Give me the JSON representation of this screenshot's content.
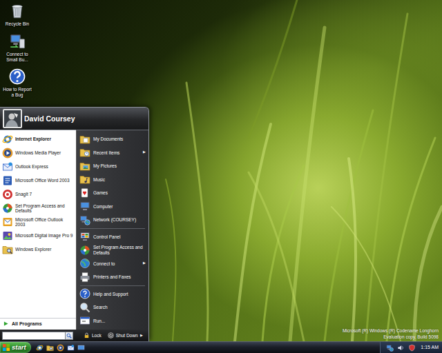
{
  "desktop": {
    "icons": [
      {
        "label": "Recycle Bin"
      },
      {
        "label": "Connect to Small Bu..."
      },
      {
        "label": "How to Report a Bug"
      }
    ]
  },
  "start_menu": {
    "user": "David Coursey",
    "pinned": [
      {
        "label": "Internet Explorer",
        "bold": true
      },
      {
        "label": "Windows Media Player",
        "bold": false
      },
      {
        "label": "Outlook Express",
        "bold": false
      },
      {
        "label": "Microsoft Office Word 2003",
        "bold": false
      },
      {
        "label": "SnagIt 7",
        "bold": false
      },
      {
        "label": "Set Program Access and Defaults",
        "bold": false
      },
      {
        "label": "Microsoft Office Outlook 2003",
        "bold": false
      },
      {
        "label": "Microsoft Digital Image Pro 9",
        "bold": false
      },
      {
        "label": "Windows Explorer",
        "bold": false
      }
    ],
    "all_programs": "All Programs",
    "submenu_arrow": "▶",
    "place_groups": [
      {
        "items": [
          {
            "label": "My Documents",
            "submenu": false
          },
          {
            "label": "Recent Items",
            "submenu": true
          },
          {
            "label": "My Pictures",
            "submenu": false
          },
          {
            "label": "Music",
            "submenu": false
          },
          {
            "label": "Games",
            "submenu": false
          },
          {
            "label": "Computer",
            "submenu": false
          },
          {
            "label": "Network (COURSEY)",
            "submenu": false
          }
        ]
      },
      {
        "items": [
          {
            "label": "Control Panel",
            "submenu": false
          },
          {
            "label": "Set Program Access and Defaults",
            "submenu": false
          },
          {
            "label": "Connect to",
            "submenu": true
          },
          {
            "label": "Printers and Faxes",
            "submenu": false
          }
        ]
      },
      {
        "items": [
          {
            "label": "Help and Support",
            "submenu": false
          },
          {
            "label": "Search",
            "submenu": false
          },
          {
            "label": "Run...",
            "submenu": false
          }
        ]
      }
    ],
    "power": [
      {
        "label": "Lock",
        "submenu": false
      },
      {
        "label": "Shut Down",
        "submenu": true
      }
    ]
  },
  "taskbar": {
    "start": "start",
    "clock": "1:15 AM"
  },
  "watermark": [
    "Microsoft (R) Windows (R) Codename Longhorn",
    "Evaluation copy. Build 5098"
  ]
}
